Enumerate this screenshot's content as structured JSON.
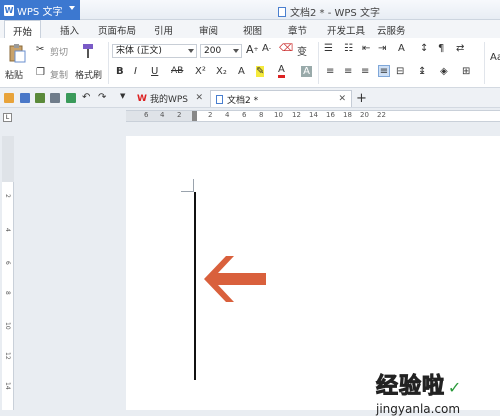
{
  "app": {
    "name": "WPS 文字",
    "window_title": "文档2 * - WPS 文字"
  },
  "tabs": [
    "开始",
    "插入",
    "页面布局",
    "引用",
    "审阅",
    "视图",
    "章节",
    "开发工具",
    "云服务"
  ],
  "ribbon": {
    "paste": "粘贴",
    "cut": "剪切",
    "copy": "复制",
    "format_painter": "格式刷",
    "font": "宋体 (正文)",
    "font_size": "200",
    "style_preview": "Aa"
  },
  "doc_tabs": {
    "home": "我的WPS",
    "current": "文档2 *"
  },
  "ruler": {
    "h_marks": [
      "6",
      "4",
      "2",
      "2",
      "4",
      "6",
      "8",
      "10",
      "12",
      "14",
      "16",
      "18",
      "20",
      "22"
    ],
    "v_marks": [
      "2",
      "4",
      "6",
      "8",
      "10",
      "12",
      "14"
    ]
  },
  "watermark": {
    "line1": "经验啦",
    "check": "✓",
    "line2": "jingyanla.com"
  },
  "colors": {
    "accent": "#3c78d0",
    "arrow": "#d9603c"
  }
}
